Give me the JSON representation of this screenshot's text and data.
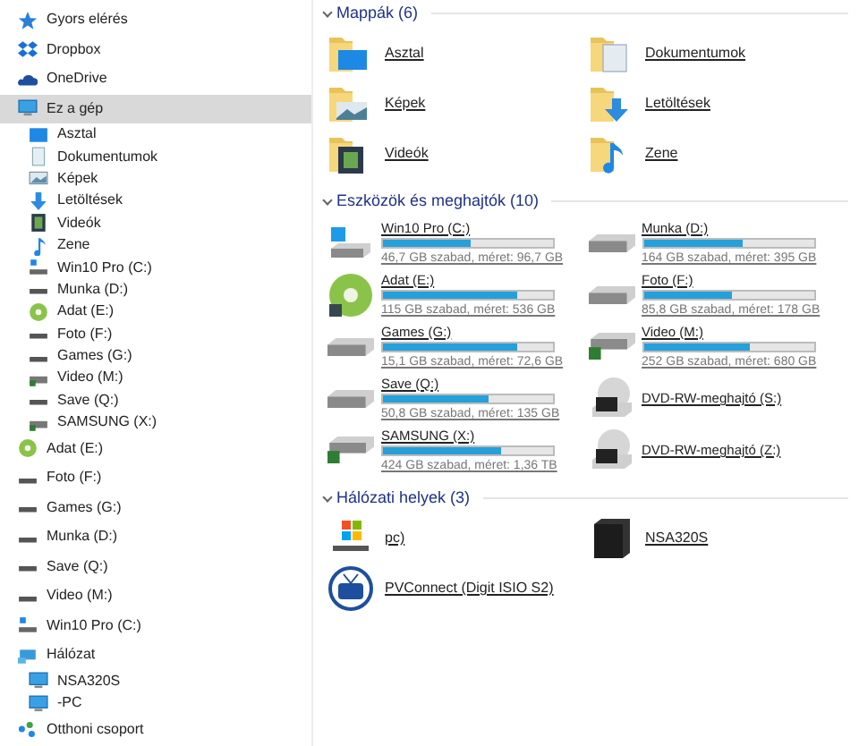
{
  "sidebar": {
    "items": [
      {
        "label": "Gyors elérés",
        "kind": "star",
        "selected": false
      },
      {
        "label": "Dropbox",
        "kind": "dropbox",
        "selected": false
      },
      {
        "label": "OneDrive",
        "kind": "cloud",
        "selected": false
      },
      {
        "label": "Ez a gép",
        "kind": "pc",
        "selected": true,
        "children": [
          {
            "label": "Asztal",
            "kind": "desktop",
            "selected": false
          },
          {
            "label": "Dokumentumok",
            "kind": "documents",
            "selected": false
          },
          {
            "label": "Képek",
            "kind": "pictures",
            "selected": false
          },
          {
            "label": "Letöltések",
            "kind": "downloads",
            "selected": false
          },
          {
            "label": "Videók",
            "kind": "videos",
            "selected": false
          },
          {
            "label": "Zene",
            "kind": "music",
            "selected": false
          },
          {
            "label": "Win10 Pro (C:)",
            "kind": "system",
            "selected": false
          },
          {
            "label": "Munka (D:)",
            "kind": "drive",
            "selected": false
          },
          {
            "label": "Adat (E:)",
            "kind": "disc",
            "selected": false
          },
          {
            "label": "Foto (F:)",
            "kind": "drive",
            "selected": false
          },
          {
            "label": "Games (G:)",
            "kind": "drive",
            "selected": false
          },
          {
            "label": "Video (M:)",
            "kind": "usb",
            "selected": false
          },
          {
            "label": "Save (Q:)",
            "kind": "drive",
            "selected": false
          },
          {
            "label": "SAMSUNG (X:)",
            "kind": "usb",
            "selected": false
          }
        ]
      },
      {
        "label": "Adat (E:)",
        "kind": "disc",
        "selected": false
      },
      {
        "label": "Foto (F:)",
        "kind": "drive",
        "selected": false
      },
      {
        "label": "Games (G:)",
        "kind": "drive",
        "selected": false
      },
      {
        "label": "Munka (D:)",
        "kind": "drive",
        "selected": false
      },
      {
        "label": "Save (Q:)",
        "kind": "drive",
        "selected": false
      },
      {
        "label": "Video (M:)",
        "kind": "drive",
        "selected": false
      },
      {
        "label": "Win10 Pro (C:)",
        "kind": "system",
        "selected": false
      },
      {
        "label": "Hálózat",
        "kind": "network",
        "selected": false,
        "children": [
          {
            "label": "NSA320S",
            "kind": "pc",
            "selected": false
          },
          {
            "label": "-PC",
            "kind": "pc",
            "selected": false
          }
        ]
      },
      {
        "label": "Otthoni csoport",
        "kind": "homegroup",
        "selected": false
      }
    ]
  },
  "sections": [
    {
      "title": "Mappák (6)",
      "expanded": true,
      "kind": "folders",
      "items": [
        {
          "name": "Asztal",
          "kind": "desktop"
        },
        {
          "name": "Dokumentumok",
          "kind": "documents"
        },
        {
          "name": "Képek",
          "kind": "pictures"
        },
        {
          "name": "Letöltések",
          "kind": "downloads"
        },
        {
          "name": "Videók",
          "kind": "videos"
        },
        {
          "name": "Zene",
          "kind": "music"
        }
      ]
    },
    {
      "title": "Eszközök és meghajtók (10)",
      "expanded": true,
      "kind": "drives",
      "items": [
        {
          "name": "Win10 Pro (C:)",
          "kind": "system",
          "level": 0.52,
          "caption": "46,7 GB szabad, méret: 96,7 GB"
        },
        {
          "name": "Munka (D:)",
          "kind": "drive",
          "level": 0.58,
          "caption": "164 GB szabad, méret: 395 GB"
        },
        {
          "name": "Adat (E:)",
          "kind": "disc",
          "level": 0.79,
          "caption": "115 GB szabad, méret: 536 GB"
        },
        {
          "name": "Foto (F:)",
          "kind": "drive",
          "level": 0.52,
          "caption": "85,8 GB szabad, méret: 178 GB"
        },
        {
          "name": "Games (G:)",
          "kind": "drive",
          "level": 0.79,
          "caption": "15,1 GB szabad, méret: 72,6 GB"
        },
        {
          "name": "Video (M:)",
          "kind": "usb",
          "level": 0.63,
          "caption": "252 GB szabad, méret: 680 GB"
        },
        {
          "name": "Save (Q:)",
          "kind": "drive",
          "level": 0.62,
          "caption": "50,8 GB szabad, méret: 135 GB"
        },
        {
          "name": "DVD-RW-meghajtó (S:)",
          "kind": "dvd"
        },
        {
          "name": "SAMSUNG (X:)",
          "kind": "usb",
          "level": 0.69,
          "caption": "424 GB szabad, méret: 1,36 TB"
        },
        {
          "name": "DVD-RW-meghajtó (Z:)",
          "kind": "dvd"
        }
      ]
    },
    {
      "title": "Hálózati helyek (3)",
      "expanded": true,
      "kind": "network",
      "items": [
        {
          "name": "pc)",
          "kind": "media"
        },
        {
          "name": "NSA320S",
          "kind": "nas"
        },
        {
          "name": "PVConnect (Digit ISIO S2)",
          "kind": "tv"
        }
      ]
    }
  ]
}
